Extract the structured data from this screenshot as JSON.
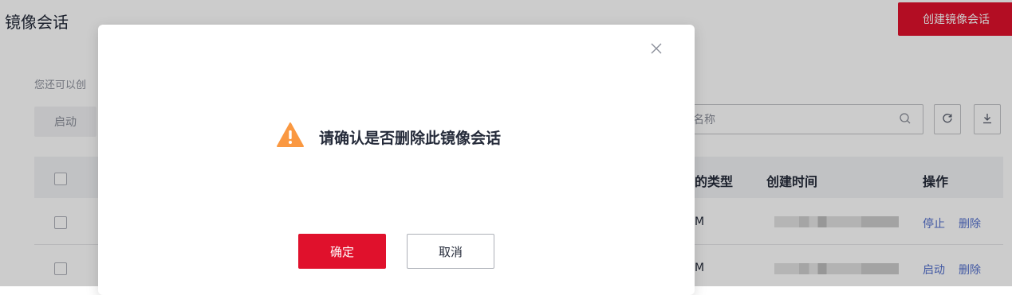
{
  "header": {
    "title": "镜像会话",
    "create_button": "创建镜像会话"
  },
  "toolbar": {
    "quota_text": "您还可以创",
    "start_button": "启动",
    "search_placeholder": "名称",
    "search_icon": "search-icon",
    "refresh_icon": "refresh-icon",
    "download_icon": "download-icon"
  },
  "table": {
    "columns": [
      "的类型",
      "创建时间",
      "操作"
    ],
    "rows": [
      {
        "type": "M",
        "actions": [
          "停止",
          "删除"
        ]
      },
      {
        "type": "M",
        "actions": [
          "启动",
          "删除"
        ]
      }
    ]
  },
  "dialog": {
    "message": "请确认是否删除此镜像会话",
    "confirm_button": "确定",
    "cancel_button": "取消",
    "close_icon": "close-icon",
    "warning_icon": "warning-icon",
    "warning_color": "#fa9841"
  },
  "colors": {
    "brand_red": "#e0112c",
    "link_blue": "#526ecc"
  }
}
